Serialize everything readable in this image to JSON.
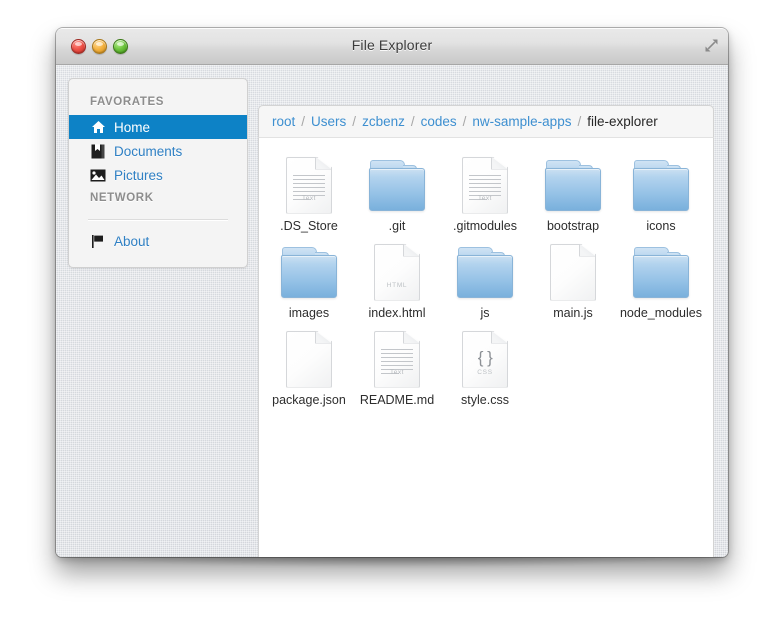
{
  "window": {
    "title": "File Explorer",
    "controls": {
      "close": "close-button",
      "minimize": "minimize-button",
      "maximize": "maximize-button",
      "fullscreen": "fullscreen-button"
    }
  },
  "sidebar": {
    "sections": [
      {
        "header": "FAVORATES",
        "items": [
          {
            "label": "Home",
            "icon": "home-icon",
            "active": true
          },
          {
            "label": "Documents",
            "icon": "documents-icon",
            "active": false
          },
          {
            "label": "Pictures",
            "icon": "pictures-icon",
            "active": false
          }
        ]
      },
      {
        "header": "NETWORK",
        "items": [
          {
            "label": "About",
            "icon": "flag-icon",
            "active": false
          }
        ]
      }
    ]
  },
  "breadcrumb": {
    "separator": "/",
    "crumbs": [
      {
        "label": "root",
        "current": false
      },
      {
        "label": "Users",
        "current": false
      },
      {
        "label": "zcbenz",
        "current": false
      },
      {
        "label": "codes",
        "current": false
      },
      {
        "label": "nw-sample-apps",
        "current": false
      },
      {
        "label": "file-explorer",
        "current": true
      }
    ]
  },
  "files": [
    {
      "name": ".DS_Store",
      "type": "file",
      "icon": "text-document-icon",
      "kind_label": "Text"
    },
    {
      "name": ".git",
      "type": "folder",
      "icon": "folder-icon",
      "kind_label": ""
    },
    {
      "name": ".gitmodules",
      "type": "file",
      "icon": "text-document-icon",
      "kind_label": "Text"
    },
    {
      "name": "bootstrap",
      "type": "folder",
      "icon": "folder-icon",
      "kind_label": ""
    },
    {
      "name": "icons",
      "type": "folder",
      "icon": "folder-icon",
      "kind_label": ""
    },
    {
      "name": "images",
      "type": "folder",
      "icon": "folder-icon",
      "kind_label": ""
    },
    {
      "name": "index.html",
      "type": "file",
      "icon": "html-document-icon",
      "kind_label": "HTML",
      "glyph": "</>"
    },
    {
      "name": "js",
      "type": "folder",
      "icon": "folder-icon",
      "kind_label": ""
    },
    {
      "name": "main.js",
      "type": "file",
      "icon": "blank-document-icon",
      "kind_label": ""
    },
    {
      "name": "node_modules",
      "type": "folder",
      "icon": "folder-icon",
      "kind_label": ""
    },
    {
      "name": "package.json",
      "type": "file",
      "icon": "blank-document-icon",
      "kind_label": ""
    },
    {
      "name": "README.md",
      "type": "file",
      "icon": "text-document-icon",
      "kind_label": "Text"
    },
    {
      "name": "style.css",
      "type": "file",
      "icon": "css-document-icon",
      "kind_label": "CSS",
      "glyph": "{ }"
    }
  ],
  "colors": {
    "accent": "#0d82c6",
    "link": "#2f80c4",
    "folder": "#94c1e6",
    "window_chrome": "#d9dce1"
  }
}
